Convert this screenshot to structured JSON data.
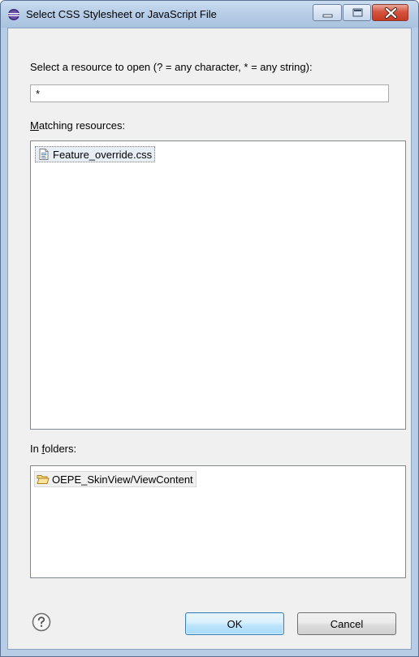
{
  "window": {
    "title": "Select CSS Stylesheet or JavaScript File",
    "icon": "eclipse-icon",
    "controls": {
      "minimize": "minimize-icon",
      "maximize": "maximize-icon",
      "close": "close-icon"
    }
  },
  "filter": {
    "prompt": "Select a resource to open (? = any character, * = any string):",
    "value": "*"
  },
  "matching": {
    "label_mnemonic": "M",
    "label_rest": "atching resources:",
    "items": [
      {
        "label": "Feature_override.css",
        "icon": "css-file-icon",
        "selected": true
      }
    ]
  },
  "folders": {
    "label_pre": "In ",
    "label_mnemonic": "f",
    "label_rest": "olders:",
    "items": [
      {
        "label": "OEPE_SkinView/ViewContent",
        "icon": "folder-open-icon"
      }
    ]
  },
  "buttons": {
    "help": "help-icon",
    "ok": "OK",
    "cancel": "Cancel"
  },
  "colors": {
    "frame": "#b7cde6",
    "client": "#f0f0f0",
    "close_button": "#c63a22",
    "default_button": "#3c7fb1"
  }
}
